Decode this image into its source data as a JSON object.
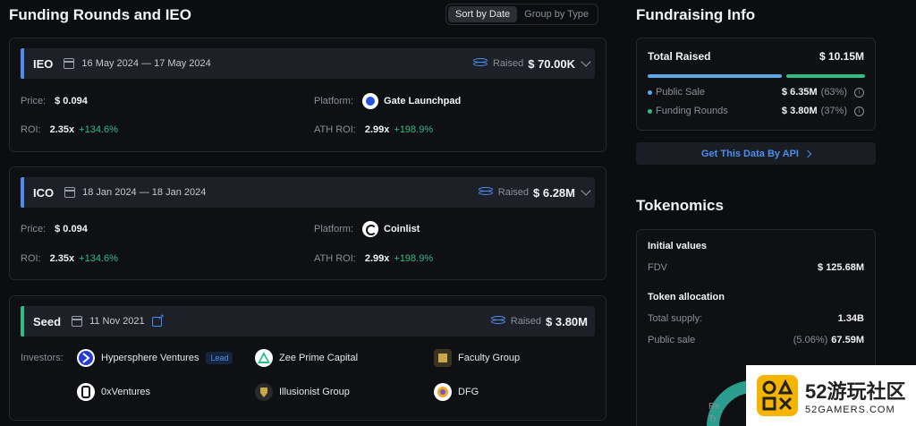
{
  "left": {
    "title": "Funding Rounds and IEO",
    "sort": {
      "by_date": "Sort by Date",
      "by_type": "Group by Type"
    }
  },
  "rounds": [
    {
      "type": "IEO",
      "dates": "16 May 2024 — 17 May 2024",
      "raised_label": "Raised",
      "raised": "$ 70.00K",
      "accent": "#4a8ff0",
      "price_label": "Price:",
      "price": "$ 0.094",
      "platform_label": "Platform:",
      "platform": "Gate Launchpad",
      "roi_label": "ROI:",
      "roi": "2.35x",
      "roi_pct": "+134.6%",
      "ath_label": "ATH ROI:",
      "ath": "2.99x",
      "ath_pct": "+198.9%"
    },
    {
      "type": "ICO",
      "dates": "18 Jan 2024 — 18 Jan 2024",
      "raised_label": "Raised",
      "raised": "$ 6.28M",
      "accent": "#4a8ff0",
      "price_label": "Price:",
      "price": "$ 0.094",
      "platform_label": "Platform:",
      "platform": "Coinlist",
      "roi_label": "ROI:",
      "roi": "2.35x",
      "roi_pct": "+134.6%",
      "ath_label": "ATH ROI:",
      "ath": "2.99x",
      "ath_pct": "+198.9%"
    },
    {
      "type": "Seed",
      "dates": "11 Nov 2021",
      "raised_label": "Raised",
      "raised": "$ 3.80M",
      "accent": "#2ebd85",
      "investors_label": "Investors:",
      "investors": [
        {
          "name": "Hypersphere Ventures",
          "badge": "Lead",
          "icon": "hypersphere-logo"
        },
        {
          "name": "Zee Prime Capital",
          "icon": "zee-prime-logo"
        },
        {
          "name": "Faculty Group",
          "icon": "faculty-logo"
        },
        {
          "name": "0xVentures",
          "icon": "0xventures-logo"
        },
        {
          "name": "Illusionist Group",
          "icon": "illusionist-logo"
        },
        {
          "name": "DFG",
          "icon": "dfg-logo"
        }
      ]
    }
  ],
  "fundraising": {
    "title": "Fundraising Info",
    "total_label": "Total Raised",
    "total": "$ 10.15M",
    "public_sale_label": "Public Sale",
    "public_sale": "$ 6.35M",
    "public_sale_pct": "(63%)",
    "funding_rounds_label": "Funding Rounds",
    "funding_rounds": "$ 3.80M",
    "funding_rounds_pct": "(37%)",
    "public_color": "#5aa8e8",
    "funding_color": "#2ebd85",
    "api_label": "Get This Data By API"
  },
  "tokenomics": {
    "title": "Tokenomics",
    "initial_label": "Initial values",
    "fdv_label": "FDV",
    "fdv": "$ 125.68M",
    "allocation_label": "Token allocation",
    "supply_label": "Total supply:",
    "supply": "1.34B",
    "public_label": "Public sale",
    "public_pct": "(5.06%)",
    "public_val": "67.59M",
    "donut_text_1": "Re",
    "donut_text_2": "Tr"
  },
  "watermark": {
    "big": "52游玩社区",
    "small": "52GAMERS.COM"
  }
}
